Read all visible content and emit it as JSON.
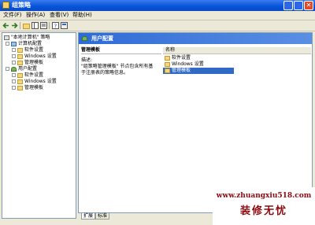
{
  "window": {
    "title": "组策略"
  },
  "menubar": {
    "items": [
      {
        "label": "文件(F)"
      },
      {
        "label": "操作(A)"
      },
      {
        "label": "查看(V)"
      },
      {
        "label": "帮助(H)"
      }
    ]
  },
  "toolbar": {
    "buttons": [
      "back-arrow-icon",
      "forward-arrow-icon",
      "up-folder-icon",
      "show-hide-tree-icon",
      "export-list-icon",
      "help-icon",
      "properties-icon"
    ]
  },
  "tree": {
    "root_label": "\"本地计算机\" 策略",
    "computer_config_label": "计算机配置",
    "computer_children": [
      {
        "label": "软件设置"
      },
      {
        "label": "Windows 设置"
      },
      {
        "label": "管理模板"
      }
    ],
    "user_config_label": "用户配置",
    "user_children": [
      {
        "label": "软件设置"
      },
      {
        "label": "Windows 设置"
      },
      {
        "label": "管理模板"
      }
    ]
  },
  "right": {
    "header_title": "用户配置",
    "desc_title": "管理模板",
    "desc_label": "描述:",
    "desc_text_1": "\"组策略管理模板\" 节点包含所有基",
    "desc_text_2": "于注册表的策略信息。",
    "column_name": "名称",
    "rows": [
      {
        "label": "软件设置"
      },
      {
        "label": "Windows 设置"
      },
      {
        "label": "管理模板"
      }
    ],
    "selected_index": 2
  },
  "tabs": [
    {
      "label": "扩展"
    },
    {
      "label": "标准"
    }
  ],
  "watermark": {
    "url": "www.zhuangxiu518.com",
    "brand": "装修无忧"
  },
  "colors": {
    "title_bar": "#0553d8",
    "selection": "#316ac5",
    "watermark": "#8b0a10"
  }
}
